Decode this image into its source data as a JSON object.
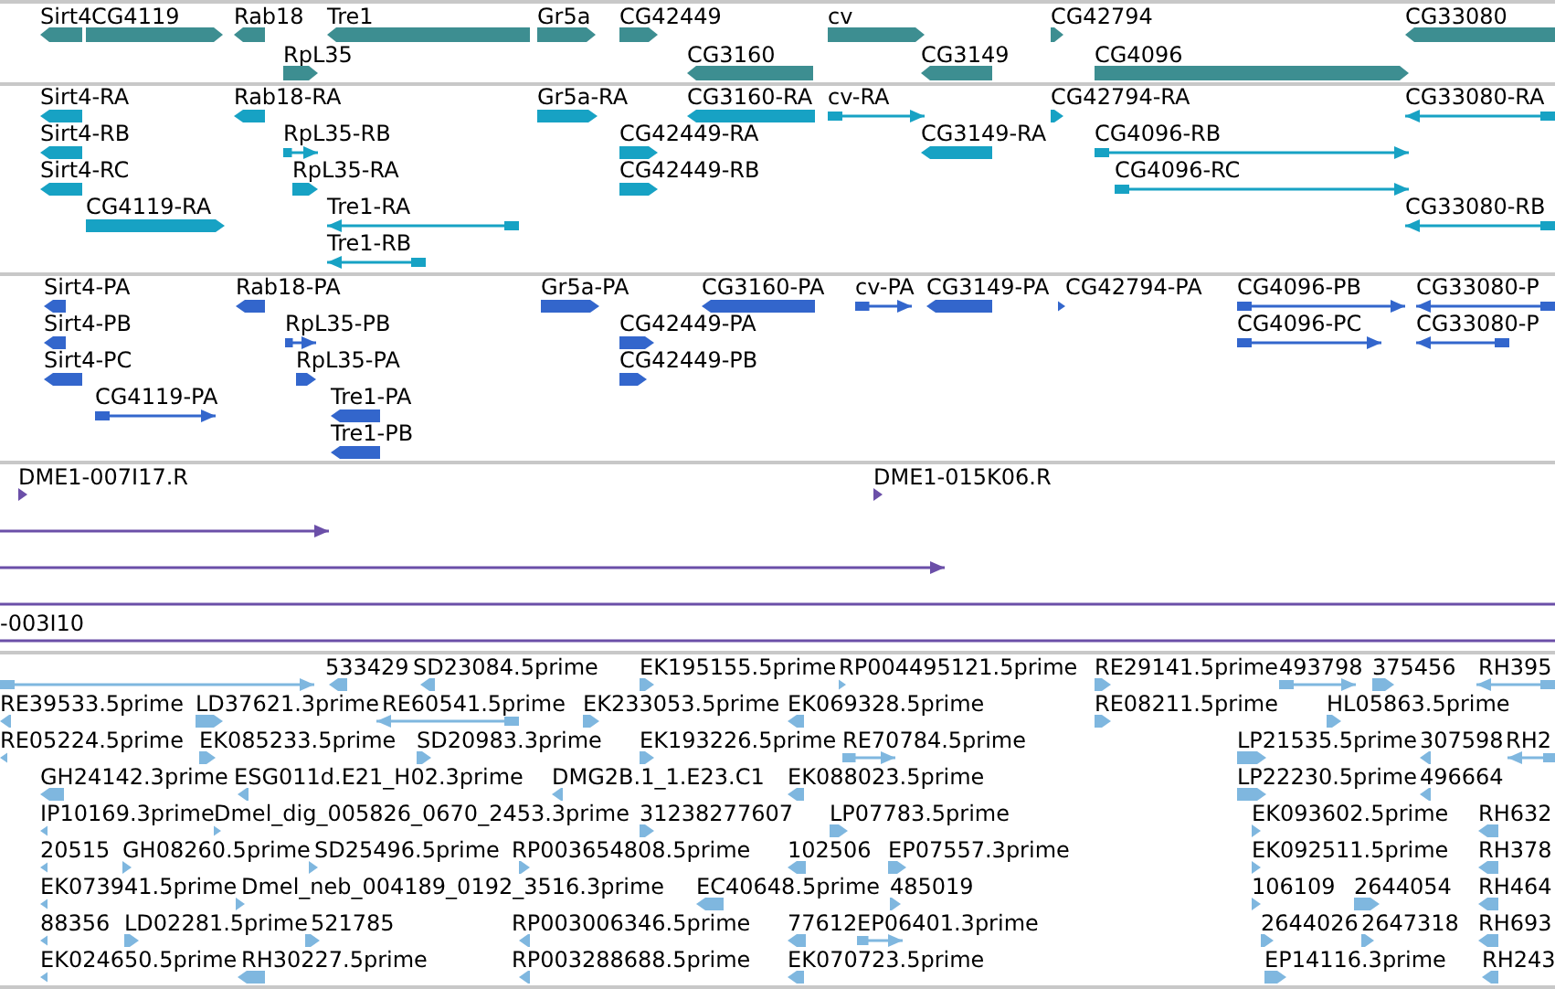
{
  "tracks": [
    {
      "kind": "gene",
      "features": [
        {
          "label": "Sirt4",
          "forward": false
        },
        {
          "label": "CG4119",
          "forward": true
        },
        {
          "label": "Rab18",
          "forward": false
        },
        {
          "label": "Tre1",
          "forward": false
        },
        {
          "label": "Gr5a",
          "forward": true
        },
        {
          "label": "CG42449",
          "forward": true
        },
        {
          "label": "cv",
          "forward": true
        },
        {
          "label": "CG42794",
          "forward": true
        },
        {
          "label": "CG33080",
          "forward": false
        },
        {
          "label": "RpL35",
          "forward": true
        },
        {
          "label": "CG3160",
          "forward": false
        },
        {
          "label": "CG3149",
          "forward": false
        },
        {
          "label": "CG4096",
          "forward": true
        }
      ]
    },
    {
      "kind": "transcript",
      "features": [
        {
          "label": "Sirt4-RA",
          "forward": false
        },
        {
          "label": "Rab18-RA",
          "forward": false
        },
        {
          "label": "Gr5a-RA",
          "forward": true
        },
        {
          "label": "CG3160-RA",
          "forward": false
        },
        {
          "label": "cv-RA",
          "forward": true
        },
        {
          "label": "CG42794-RA",
          "forward": true
        },
        {
          "label": "CG33080-RA",
          "forward": false
        },
        {
          "label": "Sirt4-RB",
          "forward": false
        },
        {
          "label": "RpL35-RB",
          "forward": true
        },
        {
          "label": "CG42449-RA",
          "forward": true
        },
        {
          "label": "CG3149-RA",
          "forward": false
        },
        {
          "label": "CG4096-RB",
          "forward": true
        },
        {
          "label": "Sirt4-RC",
          "forward": false
        },
        {
          "label": "RpL35-RA",
          "forward": true
        },
        {
          "label": "CG42449-RB",
          "forward": true
        },
        {
          "label": "CG4096-RC",
          "forward": true
        },
        {
          "label": "CG4119-RA",
          "forward": true
        },
        {
          "label": "Tre1-RA",
          "forward": false
        },
        {
          "label": "CG33080-RB",
          "forward": false
        },
        {
          "label": "Tre1-RB",
          "forward": false
        }
      ]
    },
    {
      "kind": "protein",
      "features": [
        {
          "label": "Sirt4-PA",
          "forward": false
        },
        {
          "label": "Rab18-PA",
          "forward": false
        },
        {
          "label": "Gr5a-PA",
          "forward": true
        },
        {
          "label": "CG3160-PA",
          "forward": false
        },
        {
          "label": "cv-PA",
          "forward": true
        },
        {
          "label": "CG3149-PA",
          "forward": false
        },
        {
          "label": "CG42794-PA",
          "forward": true
        },
        {
          "label": "CG4096-PB",
          "forward": true
        },
        {
          "label": "CG33080-P",
          "forward": false
        },
        {
          "label": "Sirt4-PB",
          "forward": false
        },
        {
          "label": "RpL35-PB",
          "forward": true
        },
        {
          "label": "CG42449-PA",
          "forward": true
        },
        {
          "label": "CG4096-PC",
          "forward": true
        },
        {
          "label": "CG33080-P",
          "forward": false
        },
        {
          "label": "Sirt4-PC",
          "forward": false
        },
        {
          "label": "RpL35-PA",
          "forward": true
        },
        {
          "label": "CG42449-PB",
          "forward": true
        },
        {
          "label": "CG4119-PA",
          "forward": true
        },
        {
          "label": "Tre1-PA",
          "forward": false
        },
        {
          "label": "Tre1-PB",
          "forward": false
        }
      ]
    },
    {
      "kind": "clone",
      "features": [
        {
          "kind": "clone",
          "label": "DME1-007I17.R",
          "forward": true
        },
        {
          "kind": "clone",
          "label": "DME1-015K06.R",
          "forward": true
        },
        {
          "kind": "line",
          "forward": true
        },
        {
          "kind": "line",
          "forward": true
        },
        {
          "kind": "line"
        },
        {
          "kind": "line",
          "label": "-003I10"
        }
      ]
    },
    {
      "kind": "est",
      "features": [
        {
          "forward": true
        },
        {
          "label": "533429",
          "forward": false
        },
        {
          "label": "SD23084.5prime",
          "forward": false
        },
        {
          "label": "EK195155.5prime",
          "forward": true
        },
        {
          "label": "RP004495121.5prime",
          "forward": true
        },
        {
          "label": "RE29141.5prime",
          "forward": true
        },
        {
          "label": "493798",
          "forward": true
        },
        {
          "label": "375456",
          "forward": true
        },
        {
          "label": "RH395",
          "forward": false
        },
        {
          "label": "RE39533.5prime",
          "forward": false
        },
        {
          "label": "LD37621.3prime",
          "forward": true
        },
        {
          "label": "RE60541.5prime",
          "forward": false
        },
        {
          "label": "EK233053.5prime",
          "forward": true
        },
        {
          "label": "EK069328.5prime",
          "forward": false
        },
        {
          "label": "RE08211.5prime",
          "forward": true
        },
        {
          "label": "HL05863.5prime",
          "forward": true
        },
        {
          "label": "RE05224.5prime",
          "forward": false
        },
        {
          "label": "EK085233.5prime",
          "forward": true
        },
        {
          "label": "SD20983.3prime",
          "forward": true
        },
        {
          "label": "EK193226.5prime",
          "forward": true
        },
        {
          "label": "RE70784.5prime",
          "forward": true
        },
        {
          "label": "LP21535.5prime",
          "forward": true
        },
        {
          "label": "307598",
          "forward": false
        },
        {
          "label": "RH2",
          "forward": false
        },
        {
          "label": "GH24142.3prime",
          "forward": false
        },
        {
          "label": "ESG011d.E21_H02.3prime",
          "forward": false
        },
        {
          "label": "DMG2B.1_1.E23.C1",
          "forward": false
        },
        {
          "label": "EK088023.5prime",
          "forward": false
        },
        {
          "label": "LP22230.5prime",
          "forward": true
        },
        {
          "label": "496664",
          "forward": false
        },
        {
          "label": "IP10169.3prime",
          "forward": false
        },
        {
          "label": "Dmel_dig_005826_0670_2453.3prime",
          "forward": true
        },
        {
          "label": "31238277607",
          "forward": true
        },
        {
          "label": "LP07783.5prime",
          "forward": true
        },
        {
          "label": "EK093602.5prime",
          "forward": true
        },
        {
          "label": "RH632",
          "forward": false
        },
        {
          "label": "20515",
          "forward": false
        },
        {
          "label": "GH08260.5prime",
          "forward": true
        },
        {
          "label": "SD25496.5prime",
          "forward": true
        },
        {
          "label": "RP003654808.5prime",
          "forward": true
        },
        {
          "label": "102506",
          "forward": false
        },
        {
          "label": "EP07557.3prime",
          "forward": true
        },
        {
          "label": "EK092511.5prime",
          "forward": true
        },
        {
          "label": "RH378",
          "forward": false
        },
        {
          "label": "EK073941.5prime",
          "forward": false
        },
        {
          "label": "Dmel_neb_004189_0192_3516.3prime",
          "forward": true
        },
        {
          "label": "EC40648.5prime",
          "forward": false
        },
        {
          "label": "485019",
          "forward": true
        },
        {
          "label": "106109",
          "forward": true
        },
        {
          "label": "2644054",
          "forward": true
        },
        {
          "label": "RH464",
          "forward": false
        },
        {
          "label": "88356",
          "forward": false
        },
        {
          "label": "LD02281.5prime",
          "forward": true
        },
        {
          "label": "521785",
          "forward": true
        },
        {
          "label": "RP003006346.5prime",
          "forward": false
        },
        {
          "label": "77612",
          "forward": false
        },
        {
          "label": "EP06401.3prime",
          "forward": true
        },
        {
          "label": "2644026",
          "forward": true
        },
        {
          "label": "2647318",
          "forward": true
        },
        {
          "label": "RH693",
          "forward": false
        },
        {
          "label": "EK024650.5prime",
          "forward": false
        },
        {
          "label": "RH30227.5prime",
          "forward": false
        },
        {
          "label": "RP003288688.5prime",
          "forward": false
        },
        {
          "label": "EK070723.5prime",
          "forward": false
        },
        {
          "label": "EP14116.3prime",
          "forward": true
        },
        {
          "label": "RH243",
          "forward": false
        }
      ]
    }
  ]
}
